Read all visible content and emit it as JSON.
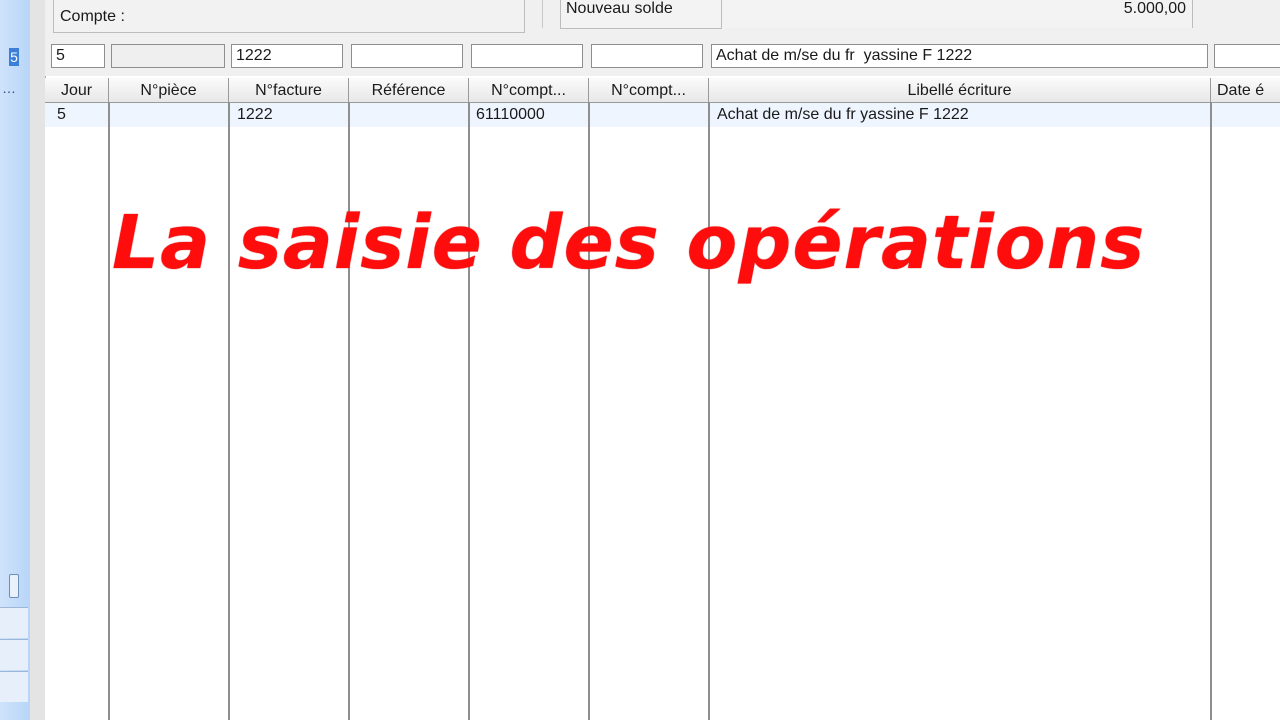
{
  "header": {
    "compte_label": "Compte :",
    "nouveau_solde_label": "Nouveau solde",
    "nouveau_solde_value": "5.000,00"
  },
  "entry": {
    "jour": "5",
    "piece": "",
    "facture": "1222",
    "reference": "",
    "compte1": "",
    "compte2": "",
    "libelle": "Achat de m/se du fr  yassine F 1222",
    "date": ""
  },
  "table": {
    "columns": [
      "Jour",
      "N°pièce",
      "N°facture",
      "Référence",
      "N°compt...",
      "N°compt...",
      "Libellé écriture",
      "Date é"
    ],
    "rows": [
      {
        "jour": "5",
        "piece": "",
        "facture": "1222",
        "reference": "",
        "compte1": "61110000",
        "compte2": "",
        "libelle": "Achat de m/se du fr  yassine F 1222",
        "date": ""
      }
    ]
  },
  "overlay": {
    "title": "La saisie des opérations"
  },
  "colors": {
    "overlay_red": "#ff0d0d",
    "side_blue": "#b8d5f8",
    "selected_row": "#eef5ff"
  }
}
